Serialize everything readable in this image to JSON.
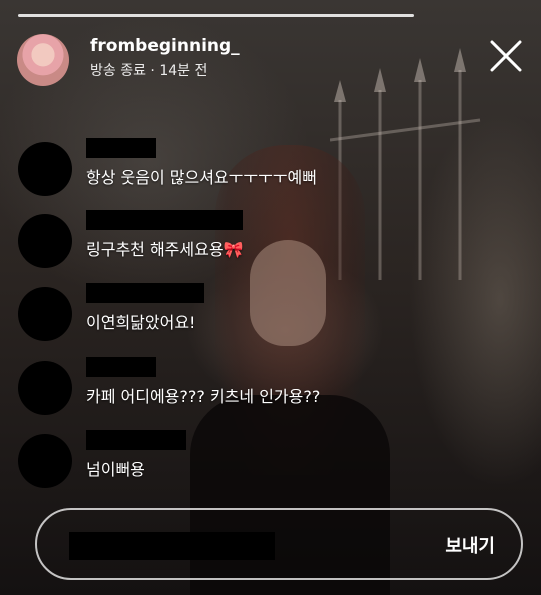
{
  "header": {
    "username": "frombeginning_",
    "subtitle": "방송 종료 · 14분 전"
  },
  "comments": [
    {
      "text": "항상 웃음이 많으셔요ㅜㅜㅜㅜ예뻐"
    },
    {
      "text": "링구추천 해주세요용🎀"
    },
    {
      "text": "이연희닮았어요!"
    },
    {
      "text": "카페 어디에용??? 키츠네 인가용??"
    },
    {
      "text": "넘이뻐용"
    }
  ],
  "composer": {
    "send_label": "보내기"
  },
  "icons": {
    "close": "close-icon"
  }
}
